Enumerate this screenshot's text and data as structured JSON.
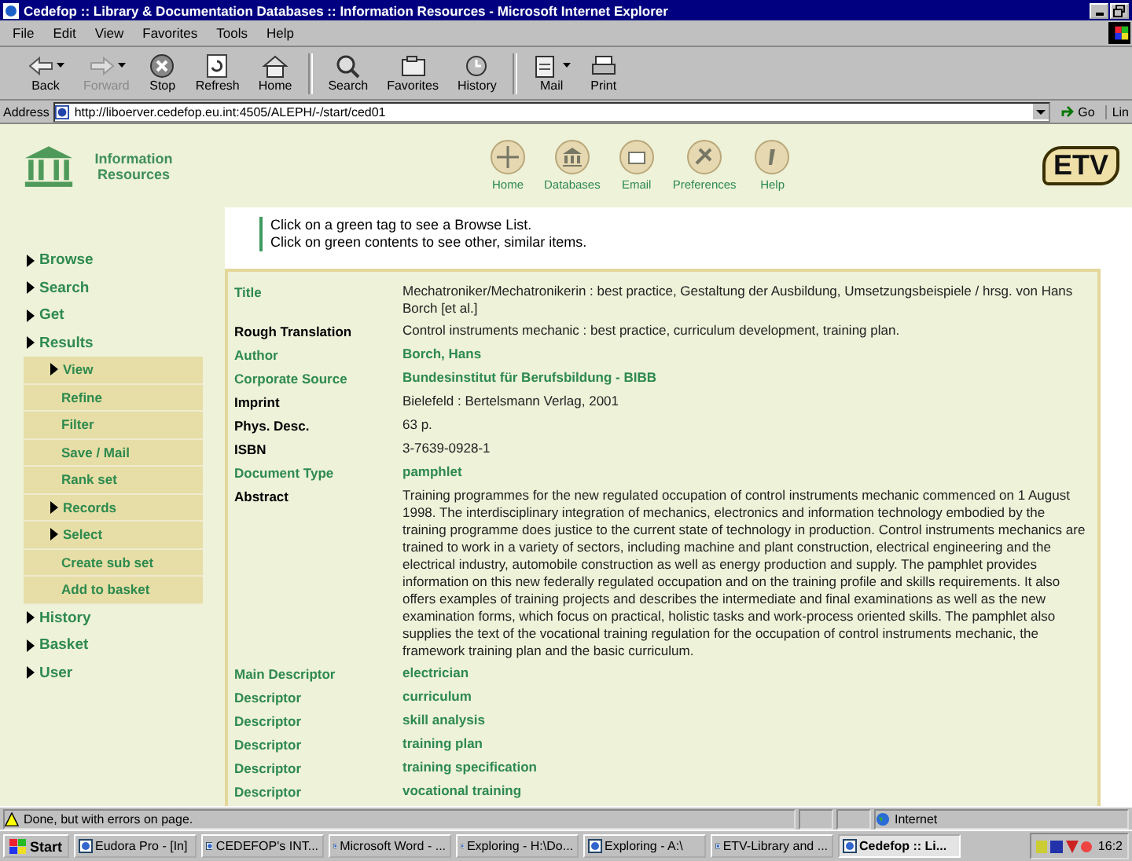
{
  "window": {
    "title": "Cedefop :: Library & Documentation Databases :: Information Resources - Microsoft Internet Explorer"
  },
  "menu": [
    "File",
    "Edit",
    "View",
    "Favorites",
    "Tools",
    "Help"
  ],
  "toolbar": [
    {
      "label": "Back",
      "kind": "back",
      "disabled": false,
      "caret": true
    },
    {
      "label": "Forward",
      "kind": "forward",
      "disabled": true,
      "caret": true
    },
    {
      "label": "Stop",
      "kind": "stop",
      "disabled": false,
      "caret": false
    },
    {
      "label": "Refresh",
      "kind": "refresh",
      "disabled": false,
      "caret": false
    },
    {
      "label": "Home",
      "kind": "home",
      "disabled": false,
      "caret": false
    },
    {
      "label": "Search",
      "kind": "search",
      "disabled": false,
      "caret": false
    },
    {
      "label": "Favorites",
      "kind": "favorites",
      "disabled": false,
      "caret": false
    },
    {
      "label": "History",
      "kind": "history",
      "disabled": false,
      "caret": false
    },
    {
      "label": "Mail",
      "kind": "mail",
      "disabled": false,
      "caret": true
    },
    {
      "label": "Print",
      "kind": "print",
      "disabled": false,
      "caret": false
    }
  ],
  "address": {
    "label": "Address",
    "value": "http://liboerver.cedefop.eu.int:4505/ALEPH/-/start/ced01",
    "go": "Go",
    "links": "Lin"
  },
  "site": {
    "logo": "Information Resources",
    "brand": "ETV",
    "nav": [
      {
        "label": "Home",
        "kind": "home"
      },
      {
        "label": "Databases",
        "kind": "databases"
      },
      {
        "label": "Email",
        "kind": "email"
      },
      {
        "label": "Preferences",
        "kind": "preferences"
      },
      {
        "label": "Help",
        "kind": "help"
      }
    ]
  },
  "sidebar": [
    {
      "label": "Browse",
      "arrow": true
    },
    {
      "label": "Search",
      "arrow": true
    },
    {
      "label": "Get",
      "arrow": true
    },
    {
      "label": "Results",
      "arrow": true,
      "expanded": true,
      "children": [
        {
          "label": "View",
          "arrow": true
        },
        {
          "label": "Refine",
          "arrow": false
        },
        {
          "label": "Filter",
          "arrow": false
        },
        {
          "label": "Save / Mail",
          "arrow": false
        },
        {
          "label": "Rank set",
          "arrow": false
        },
        {
          "label": "Records",
          "arrow": true
        },
        {
          "label": "Select",
          "arrow": true
        },
        {
          "label": "Create sub set",
          "arrow": false
        },
        {
          "label": "Add to basket",
          "arrow": false
        }
      ]
    },
    {
      "label": "History",
      "arrow": true
    },
    {
      "label": "Basket",
      "arrow": true
    },
    {
      "label": "User",
      "arrow": true
    }
  ],
  "hints": [
    "Click on a green tag to see a Browse List.",
    "Click on green contents to see other, similar items."
  ],
  "record": [
    {
      "label": "Title",
      "label_link": true,
      "value": "Mechatroniker/Mechatronikerin : best practice, Gestaltung der Ausbildung, Umsetzungsbeispiele / hrsg. von Hans Borch [et al.]",
      "value_link": false
    },
    {
      "label": "Rough Translation",
      "label_link": false,
      "value": "Control instruments mechanic : best practice, curriculum development, training plan.",
      "value_link": false
    },
    {
      "label": "Author",
      "label_link": true,
      "value": "Borch, Hans",
      "value_link": true
    },
    {
      "label": "Corporate Source",
      "label_link": true,
      "value": "Bundesinstitut für Berufsbildung - BIBB",
      "value_link": true
    },
    {
      "label": "Imprint",
      "label_link": false,
      "value": "Bielefeld : Bertelsmann Verlag, 2001",
      "value_link": false
    },
    {
      "label": "Phys. Desc.",
      "label_link": false,
      "value": "63 p.",
      "value_link": false
    },
    {
      "label": "ISBN",
      "label_link": false,
      "value": "3-7639-0928-1",
      "value_link": false
    },
    {
      "label": "Document Type",
      "label_link": true,
      "value": "pamphlet",
      "value_link": true
    },
    {
      "label": "Abstract",
      "label_link": false,
      "value": "Training programmes for the new regulated occupation of control instruments mechanic commenced on 1 August 1998. The interdisciplinary integration of mechanics, electronics and information technology embodied by the training programme does justice to the current state of technology in production. Control instruments mechanics are trained to work in a variety of sectors, including machine and plant construction, electrical engineering and the electrical industry, automobile construction as well as energy production and supply. The pamphlet provides information on this new federally regulated occupation and on the training profile and skills requirements. It also offers examples of training projects and describes the intermediate and final examinations as well as the new examination forms, which focus on practical, holistic tasks and work-process oriented skills. The pamphlet also supplies the text of the vocational training regulation for the occupation of control instruments mechanic, the framework training plan and the basic curriculum.",
      "value_link": false
    },
    {
      "label": "Main Descriptor",
      "label_link": true,
      "value": "electrician",
      "value_link": true
    },
    {
      "label": "Descriptor",
      "label_link": true,
      "value": "curriculum",
      "value_link": true
    },
    {
      "label": "Descriptor",
      "label_link": true,
      "value": "skill analysis",
      "value_link": true
    },
    {
      "label": "Descriptor",
      "label_link": true,
      "value": "training plan",
      "value_link": true
    },
    {
      "label": "Descriptor",
      "label_link": true,
      "value": "training specification",
      "value_link": true
    },
    {
      "label": "Descriptor",
      "label_link": true,
      "value": "vocational training",
      "value_link": true
    }
  ],
  "status_bar": {
    "message": "Done, but with errors on page.",
    "zone": "Internet"
  },
  "taskbar": {
    "start": "Start",
    "time": "16:2",
    "tasks": [
      {
        "label": "Eudora Pro - [In]",
        "selected": false
      },
      {
        "label": "CEDEFOP's INT...",
        "selected": false
      },
      {
        "label": "Microsoft Word - ...",
        "selected": false
      },
      {
        "label": "Exploring - H:\\Do...",
        "selected": false
      },
      {
        "label": "Exploring - A:\\",
        "selected": false
      },
      {
        "label": "ETV-Library and ...",
        "selected": false
      },
      {
        "label": "Cedefop :: Li...",
        "selected": true
      }
    ]
  }
}
